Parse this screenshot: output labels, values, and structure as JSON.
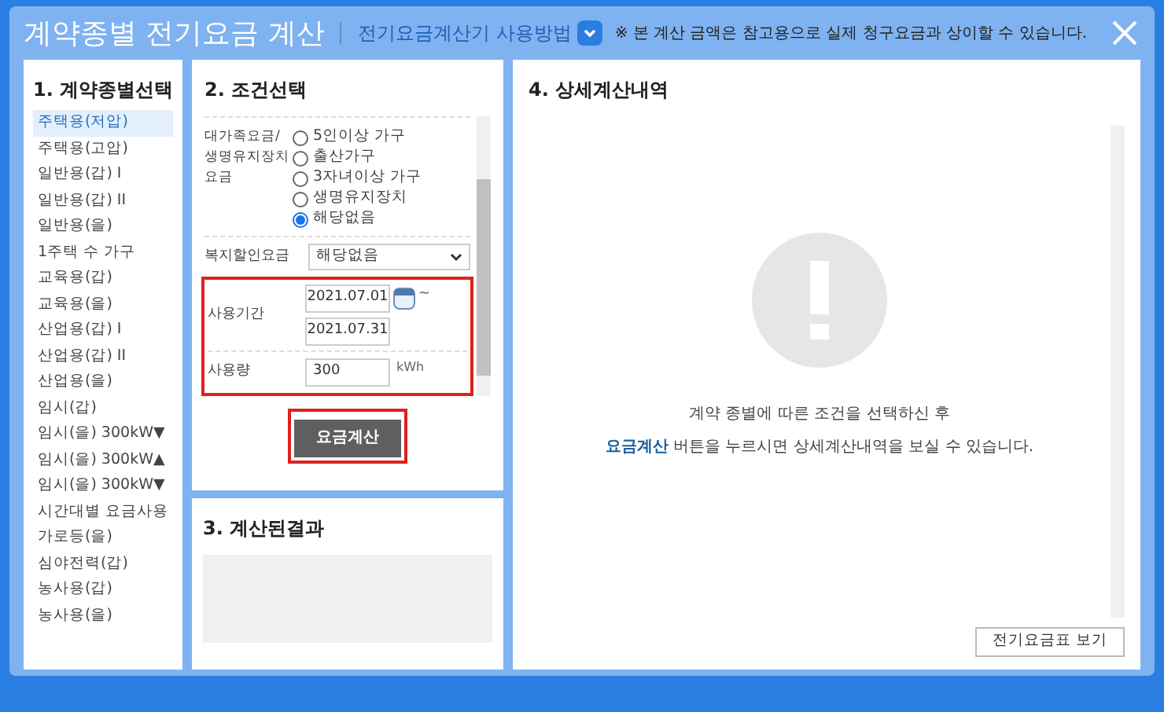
{
  "window": {
    "title": "계약종별 전기요금 계산",
    "help_link": "전기요금계산기 사용방법",
    "notice": "※ 본 계산 금액은 참고용으로 실제 청구요금과 상이할 수 있습니다."
  },
  "contract_types": {
    "title": "1. 계약종별선택",
    "items": [
      {
        "label": "주택용(저압)",
        "selected": true
      },
      {
        "label": "주택용(고압)",
        "selected": false
      },
      {
        "label": "일반용(갑) I",
        "selected": false
      },
      {
        "label": "일반용(갑) II",
        "selected": false
      },
      {
        "label": "일반용(을)",
        "selected": false
      },
      {
        "label": "1주택 수 가구",
        "selected": false
      },
      {
        "label": "교육용(갑)",
        "selected": false
      },
      {
        "label": "교육용(을)",
        "selected": false
      },
      {
        "label": "산업용(갑) I",
        "selected": false
      },
      {
        "label": "산업용(갑) II",
        "selected": false
      },
      {
        "label": "산업용(을)",
        "selected": false
      },
      {
        "label": "임시(갑)",
        "selected": false
      },
      {
        "label": "임시(을) 300kW▼",
        "selected": false
      },
      {
        "label": "임시(을) 300kW▲",
        "selected": false
      },
      {
        "label": "임시(을) 300kW▼",
        "selected": false
      },
      {
        "label": "시간대별 요금사용",
        "selected": false
      },
      {
        "label": "가로등(을)",
        "selected": false
      },
      {
        "label": "심야전력(갑)",
        "selected": false
      },
      {
        "label": "농사용(갑)",
        "selected": false
      },
      {
        "label": "농사용(을)",
        "selected": false
      }
    ]
  },
  "conditions": {
    "title": "2. 조건선택",
    "family_rate": {
      "label": "대가족요금/ 생명유지장치 요금",
      "options": [
        {
          "label": "5인이상 가구",
          "selected": false
        },
        {
          "label": "출산가구",
          "selected": false
        },
        {
          "label": "3자녀이상 가구",
          "selected": false
        },
        {
          "label": "생명유지장치",
          "selected": false
        },
        {
          "label": "해당없음",
          "selected": true
        }
      ]
    },
    "welfare": {
      "label": "복지할인요금",
      "value": "해당없음"
    },
    "period": {
      "label": "사용기간",
      "start": "2021.07.01",
      "end": "2021.07.31",
      "separator": "~"
    },
    "usage": {
      "label": "사용량",
      "value": "300",
      "unit": "kWh"
    },
    "calculate_button": "요금계산"
  },
  "result": {
    "title": "3. 계산된결과"
  },
  "details": {
    "title": "4. 상세계산내역",
    "message_line1": "계약 종별에 따른 조건을 선택하신 후",
    "message_highlight": "요금계산",
    "message_line2": " 버튼을 누르시면 상세계산내역을 보실 수 있습니다.",
    "table_button": "전기요금표 보기"
  }
}
